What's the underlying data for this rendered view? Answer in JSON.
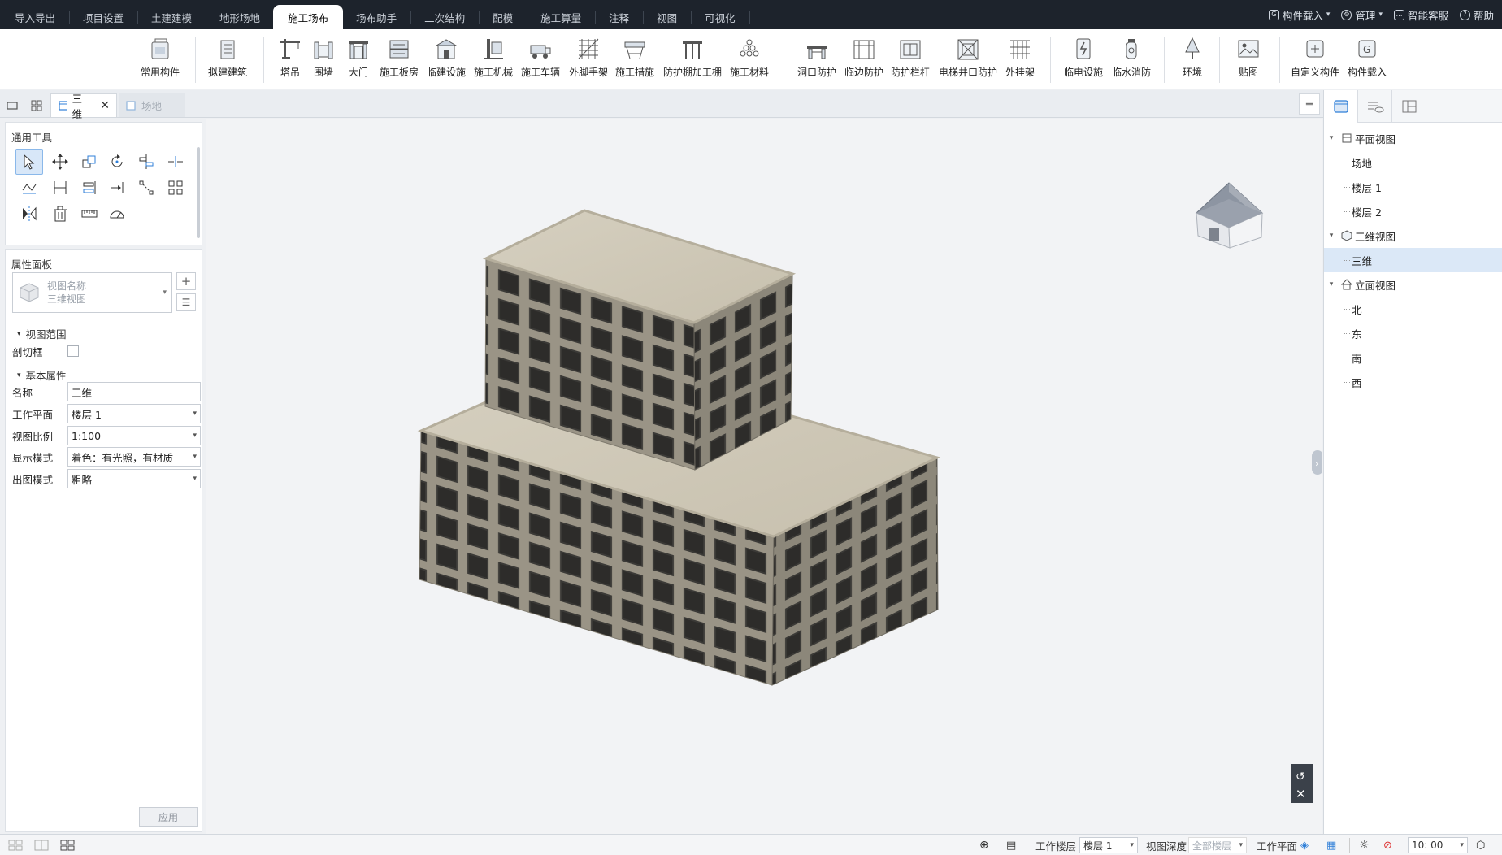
{
  "menu": {
    "tabs": [
      "导入导出",
      "项目设置",
      "土建建模",
      "地形场地",
      "施工场布",
      "场布助手",
      "二次结构",
      "配模",
      "施工算量",
      "注释",
      "视图",
      "可视化"
    ],
    "active_tab": "施工场布",
    "right": {
      "component_load": "构件载入",
      "manage": "管理",
      "smart_service": "智能客服",
      "help": "帮助"
    }
  },
  "ribbon": {
    "buttons": [
      "常用构件",
      "拟建建筑",
      "塔吊",
      "围墙",
      "大门",
      "施工板房",
      "临建设施",
      "施工机械",
      "施工车辆",
      "外脚手架",
      "施工措施",
      "防护棚加工棚",
      "施工材料",
      "洞口防护",
      "临边防护",
      "防护栏杆",
      "电梯井口防护",
      "外挂架",
      "临电设施",
      "临水消防",
      "环境",
      "贴图",
      "自定义构件",
      "构件载入"
    ]
  },
  "view_tabs": {
    "active": "三维",
    "inactive": "场地"
  },
  "left": {
    "general_tools_title": "通用工具",
    "properties_title": "属性面板",
    "view_name_label": "视图名称",
    "view_name_value": "三维视图",
    "section_view_range": "视图范围",
    "crop_box_label": "剖切框",
    "section_basic": "基本属性",
    "props": [
      {
        "label": "名称",
        "value": "三维"
      },
      {
        "label": "工作平面",
        "value": "楼层 1"
      },
      {
        "label": "视图比例",
        "value": "1:100"
      },
      {
        "label": "显示模式",
        "value": "着色：有光照，有材质"
      },
      {
        "label": "出图模式",
        "value": "粗略"
      }
    ],
    "apply_button": "应用"
  },
  "tree": {
    "plan_views": "平面视图",
    "plan_items": [
      "场地",
      "楼层 1",
      "楼层 2"
    ],
    "three_d_views": "三维视图",
    "three_d_items": [
      "三维"
    ],
    "elevation_views": "立面视图",
    "elevation_items": [
      "北",
      "东",
      "南",
      "西"
    ]
  },
  "status": {
    "work_floor_label": "工作楼层",
    "work_floor_value": "楼层 1",
    "view_depth_label": "视图深度",
    "view_depth_value": "全部楼层",
    "work_plane_label": "工作平面",
    "time_value": "10: 00"
  },
  "colors": {
    "menubar_bg": "#1d232c",
    "accent": "#2f7fd8",
    "roof": "#cfc8b8",
    "facade_light": "#9a9486",
    "facade_dark": "#7f7a6e",
    "window": "#3a3a38"
  }
}
